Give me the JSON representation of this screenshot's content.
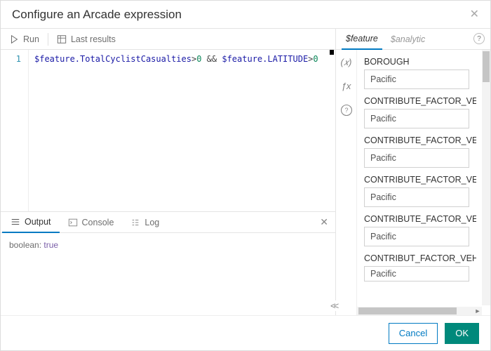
{
  "header": {
    "title": "Configure an Arcade expression"
  },
  "toolbar": {
    "run": "Run",
    "last_results": "Last results"
  },
  "editor": {
    "line_no": "1",
    "tokens": {
      "t1": "$feature.TotalCyclistCasualties",
      "op1": ">",
      "n1": "0",
      "op2": " && ",
      "t2": "$feature.LATITUDE",
      "op3": ">",
      "n2": "0"
    }
  },
  "bottom": {
    "tabs": {
      "output": "Output",
      "console": "Console",
      "log": "Log"
    },
    "output": {
      "type": "boolean:",
      "value": "true"
    }
  },
  "right": {
    "tabs": {
      "feature": "$feature",
      "analytic": "$analytic"
    },
    "rail": {
      "var": "(𝑥)",
      "fx": "ƒx"
    },
    "fields": [
      {
        "label": "BOROUGH",
        "value": "Pacific"
      },
      {
        "label": "CONTRIBUTE_FACTOR_VEHICLE",
        "value": "Pacific"
      },
      {
        "label": "CONTRIBUTE_FACTOR_VEHICLE",
        "value": "Pacific"
      },
      {
        "label": "CONTRIBUTE_FACTOR_VEHICLE",
        "value": "Pacific"
      },
      {
        "label": "CONTRIBUTE_FACTOR_VEHICLE",
        "value": "Pacific"
      },
      {
        "label": "CONTRIBUT_FACTOR_VEHICLE_",
        "value": "Pacific"
      }
    ]
  },
  "footer": {
    "cancel": "Cancel",
    "ok": "OK"
  }
}
